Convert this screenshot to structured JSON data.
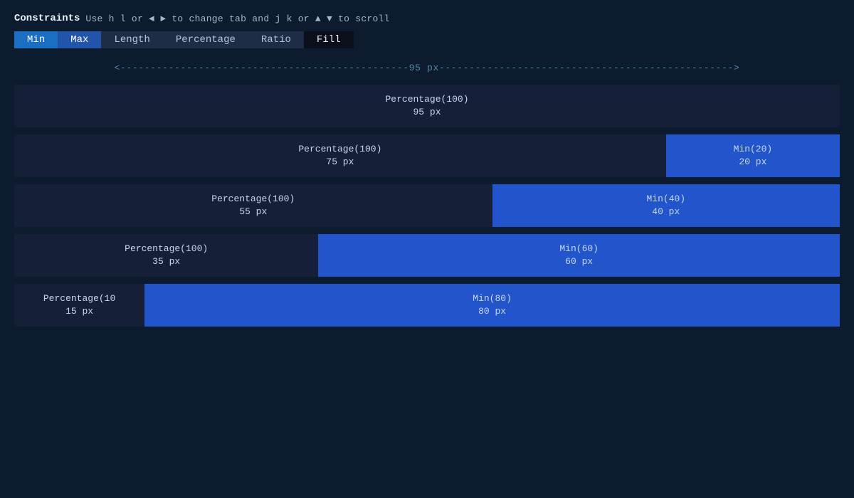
{
  "header": {
    "constraints_label": "Constraints",
    "hint": "Use h l or ◄ ► to change tab and j k or ▲ ▼ to scroll"
  },
  "tabs": [
    {
      "id": "min",
      "label": "Min",
      "active": true,
      "selected": true
    },
    {
      "id": "max",
      "label": "Max",
      "active": true,
      "selected": false
    },
    {
      "id": "length",
      "label": "Length",
      "active": false
    },
    {
      "id": "percentage",
      "label": "Percentage",
      "active": false
    },
    {
      "id": "ratio",
      "label": "Ratio",
      "active": false
    },
    {
      "id": "fill",
      "label": "Fill",
      "active": false,
      "dark": true
    }
  ],
  "ruler": "<------------------------------------------------95 px------------------------------------------------->",
  "rows": [
    {
      "segments": [
        {
          "type": "dark",
          "flex": 100,
          "label": "Percentage(100)",
          "value": "95 px"
        }
      ]
    },
    {
      "segments": [
        {
          "type": "dark",
          "flex": 75,
          "label": "Percentage(100)",
          "value": "75 px"
        },
        {
          "type": "blue",
          "flex": 20,
          "label": "Min(20)",
          "value": "20 px"
        }
      ]
    },
    {
      "segments": [
        {
          "type": "dark",
          "flex": 55,
          "label": "Percentage(100)",
          "value": "55 px"
        },
        {
          "type": "blue",
          "flex": 40,
          "label": "Min(40)",
          "value": "40 px"
        }
      ]
    },
    {
      "segments": [
        {
          "type": "dark",
          "flex": 35,
          "label": "Percentage(100)",
          "value": "35 px"
        },
        {
          "type": "blue",
          "flex": 60,
          "label": "Min(60)",
          "value": "60 px"
        }
      ]
    },
    {
      "segments": [
        {
          "type": "dark",
          "flex": 15,
          "label": "Percentage(10",
          "value": "15 px",
          "overflow": true
        },
        {
          "type": "blue",
          "flex": 80,
          "label": "Min(80)",
          "value": "80 px"
        }
      ]
    }
  ],
  "colors": {
    "bg": "#0d1b2e",
    "dark_segment": "#152038",
    "blue_segment": "#2255cc",
    "tab_min": "#1a6fc4",
    "tab_max": "#2255aa",
    "tab_inactive": "#1e2d45",
    "tab_fill": "#0a0f1a"
  }
}
